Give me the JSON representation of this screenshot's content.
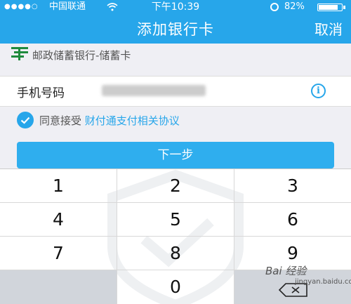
{
  "status_bar": {
    "signal": "●●●●○",
    "carrier": "中国联通",
    "time": "下午10:39",
    "battery": "82%",
    "battery_level": 0.82
  },
  "nav": {
    "title": "添加银行卡",
    "cancel_label": "取消"
  },
  "bank": {
    "name": "邮政储蓄银行-储蓄卡",
    "icon": "china-post-logo-icon",
    "icon_color": "#1f8a3d"
  },
  "phone": {
    "label": "手机号码",
    "value_blurred": "●●●●●●●●●●●",
    "info_symbol": "i"
  },
  "agreement": {
    "prefix": "同意接受",
    "link": "财付通支付相关协议",
    "checked": true
  },
  "next_button": {
    "label": "下一步"
  },
  "keypad": {
    "keys": [
      "1",
      "2",
      "3",
      "4",
      "5",
      "6",
      "7",
      "8",
      "9",
      "",
      "0",
      "⌫"
    ]
  },
  "watermark": {
    "text": "Bai 经验",
    "sub": "jingyan.baidu.com"
  },
  "colors": {
    "accent": "#27a6ea",
    "button": "#2faeee",
    "background": "#efeff4",
    "keypad_dark": "#d1d5db"
  }
}
